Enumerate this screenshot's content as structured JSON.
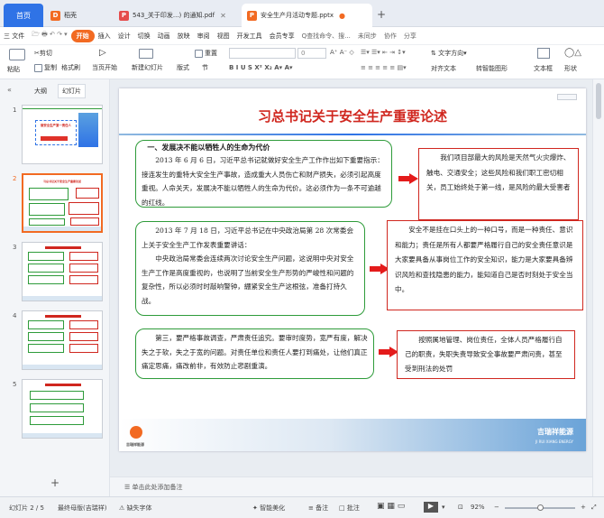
{
  "tabs": [
    {
      "label": "首页"
    },
    {
      "label": "稻壳"
    },
    {
      "label": "543_关于印发...) 的通知.pdf"
    },
    {
      "label": "安全生产月活动专题.pptx"
    }
  ],
  "tab_add": "+",
  "menu": {
    "file": "三 文件",
    "items": [
      "开始",
      "插入",
      "设计",
      "切换",
      "动画",
      "放映",
      "审阅",
      "视图",
      "开发工具",
      "会员专享"
    ],
    "search": "Q查找命令、搜...",
    "sync": "未同步",
    "collab": "协作",
    "share": "分享"
  },
  "ribbon": {
    "paste": "粘贴",
    "cut": "剪切",
    "copy": "复制",
    "format_painter": "格式刷",
    "from_current": "当页开始",
    "new_slide": "新建幻灯片",
    "layout": "版式",
    "section": "节",
    "reset": "重置",
    "text_box": "文本框",
    "shape": "形状",
    "convert_art": "转智能图形",
    "align_text": "对齐文本",
    "text_box_btn": "文本框",
    "shape_btn": "形状",
    "font_size": "0"
  },
  "left_panel": {
    "tab_outline": "大纲",
    "tab_slides": "幻灯片",
    "add": "+",
    "thumbnails": [
      {
        "num": "1",
        "title": "做安全生产第一责任人"
      },
      {
        "num": "2",
        "title": "习总书记关于安全生产重要论述"
      },
      {
        "num": "3",
        "title": ""
      },
      {
        "num": "4",
        "title": ""
      },
      {
        "num": "5",
        "title": ""
      }
    ]
  },
  "slide": {
    "title": "习总书记关于安全生产重要论述",
    "box1_heading": "一、发展决不能以牺牲人的生命为代价",
    "box1_text": "2013 年 6 月 6 日，习近平总书记就做好安全生产工作作出如下重要指示：接连发生的重特大安全生产事故，造成重大人员伤亡和财产损失，必须引起高度重视。人命关天，发展决不能以牺牲人的生命为代价。这必须作为一条不可逾越的红线。",
    "box1_note": "我们项目部最大的风险是天然气火灾爆炸、触电、交通安全；这些风险和我们职工密切相关，员工始终处于第一线，是风险的最大受害者",
    "box2_text1": "2013 年 7 月 18 日，习近平总书记在中央政治局第 28 次常委会上关于安全生产工作发表重要讲话：",
    "box2_text2": "中央政治局常委会连续两次讨论安全生产问题，这说明中央对安全生产工作是高度重视的，也说明了当前安全生产形势的严峻性和问题的复杂性，所以必须时时敲响警钟，綳紧安全生产这根弦，准备打持久战。",
    "box2_note": "安全不是挂在口头上的一种口号，而是一种责任、意识和能力；责任是所有人都要严格履行自己的安全责任意识是大家要具备从事岗位工作的安全知识，能力是大家要具备辨识风险和查找隐患的能力，能知道自己是否时刻处于安全当中。",
    "box3_text": "第三，要严格事故调查，严肃责任追究。要审时度势，宽严有度，解决失之于软，失之于宽的问题。对责任单位和责任人要打到痛处，让他们真正痛定思痛，痛改前非，有效防止悲剧重演。",
    "box3_note": "按照属地管理、岗位责任，全体人员严格履行自己的职责，失职失责导致安全事故要严肃问责，甚至受到刑法的处罚",
    "footer_brand": "吉瑞祥能源",
    "footer_brand_sub": "JI RUI XIANG ENERGY",
    "logo_text": "吉瑞祥能源"
  },
  "notes_placeholder": "单击此处添加备注",
  "status": {
    "slide_counter": "幻灯片 2 / 5",
    "theme": "最终母版(吉瑞祥)",
    "missing_font": "缺失字体",
    "smart_beautify": "智能美化",
    "notes": "备注",
    "comments": "批注",
    "zoom": "92%",
    "zoom_minus": "−",
    "zoom_plus": "+"
  },
  "colors": {
    "accent_orange": "#f26a22",
    "title_red": "#d0271f",
    "box_green": "#2e9b3a",
    "arrow_red": "#e41b1b",
    "home_blue": "#2f73e6"
  }
}
